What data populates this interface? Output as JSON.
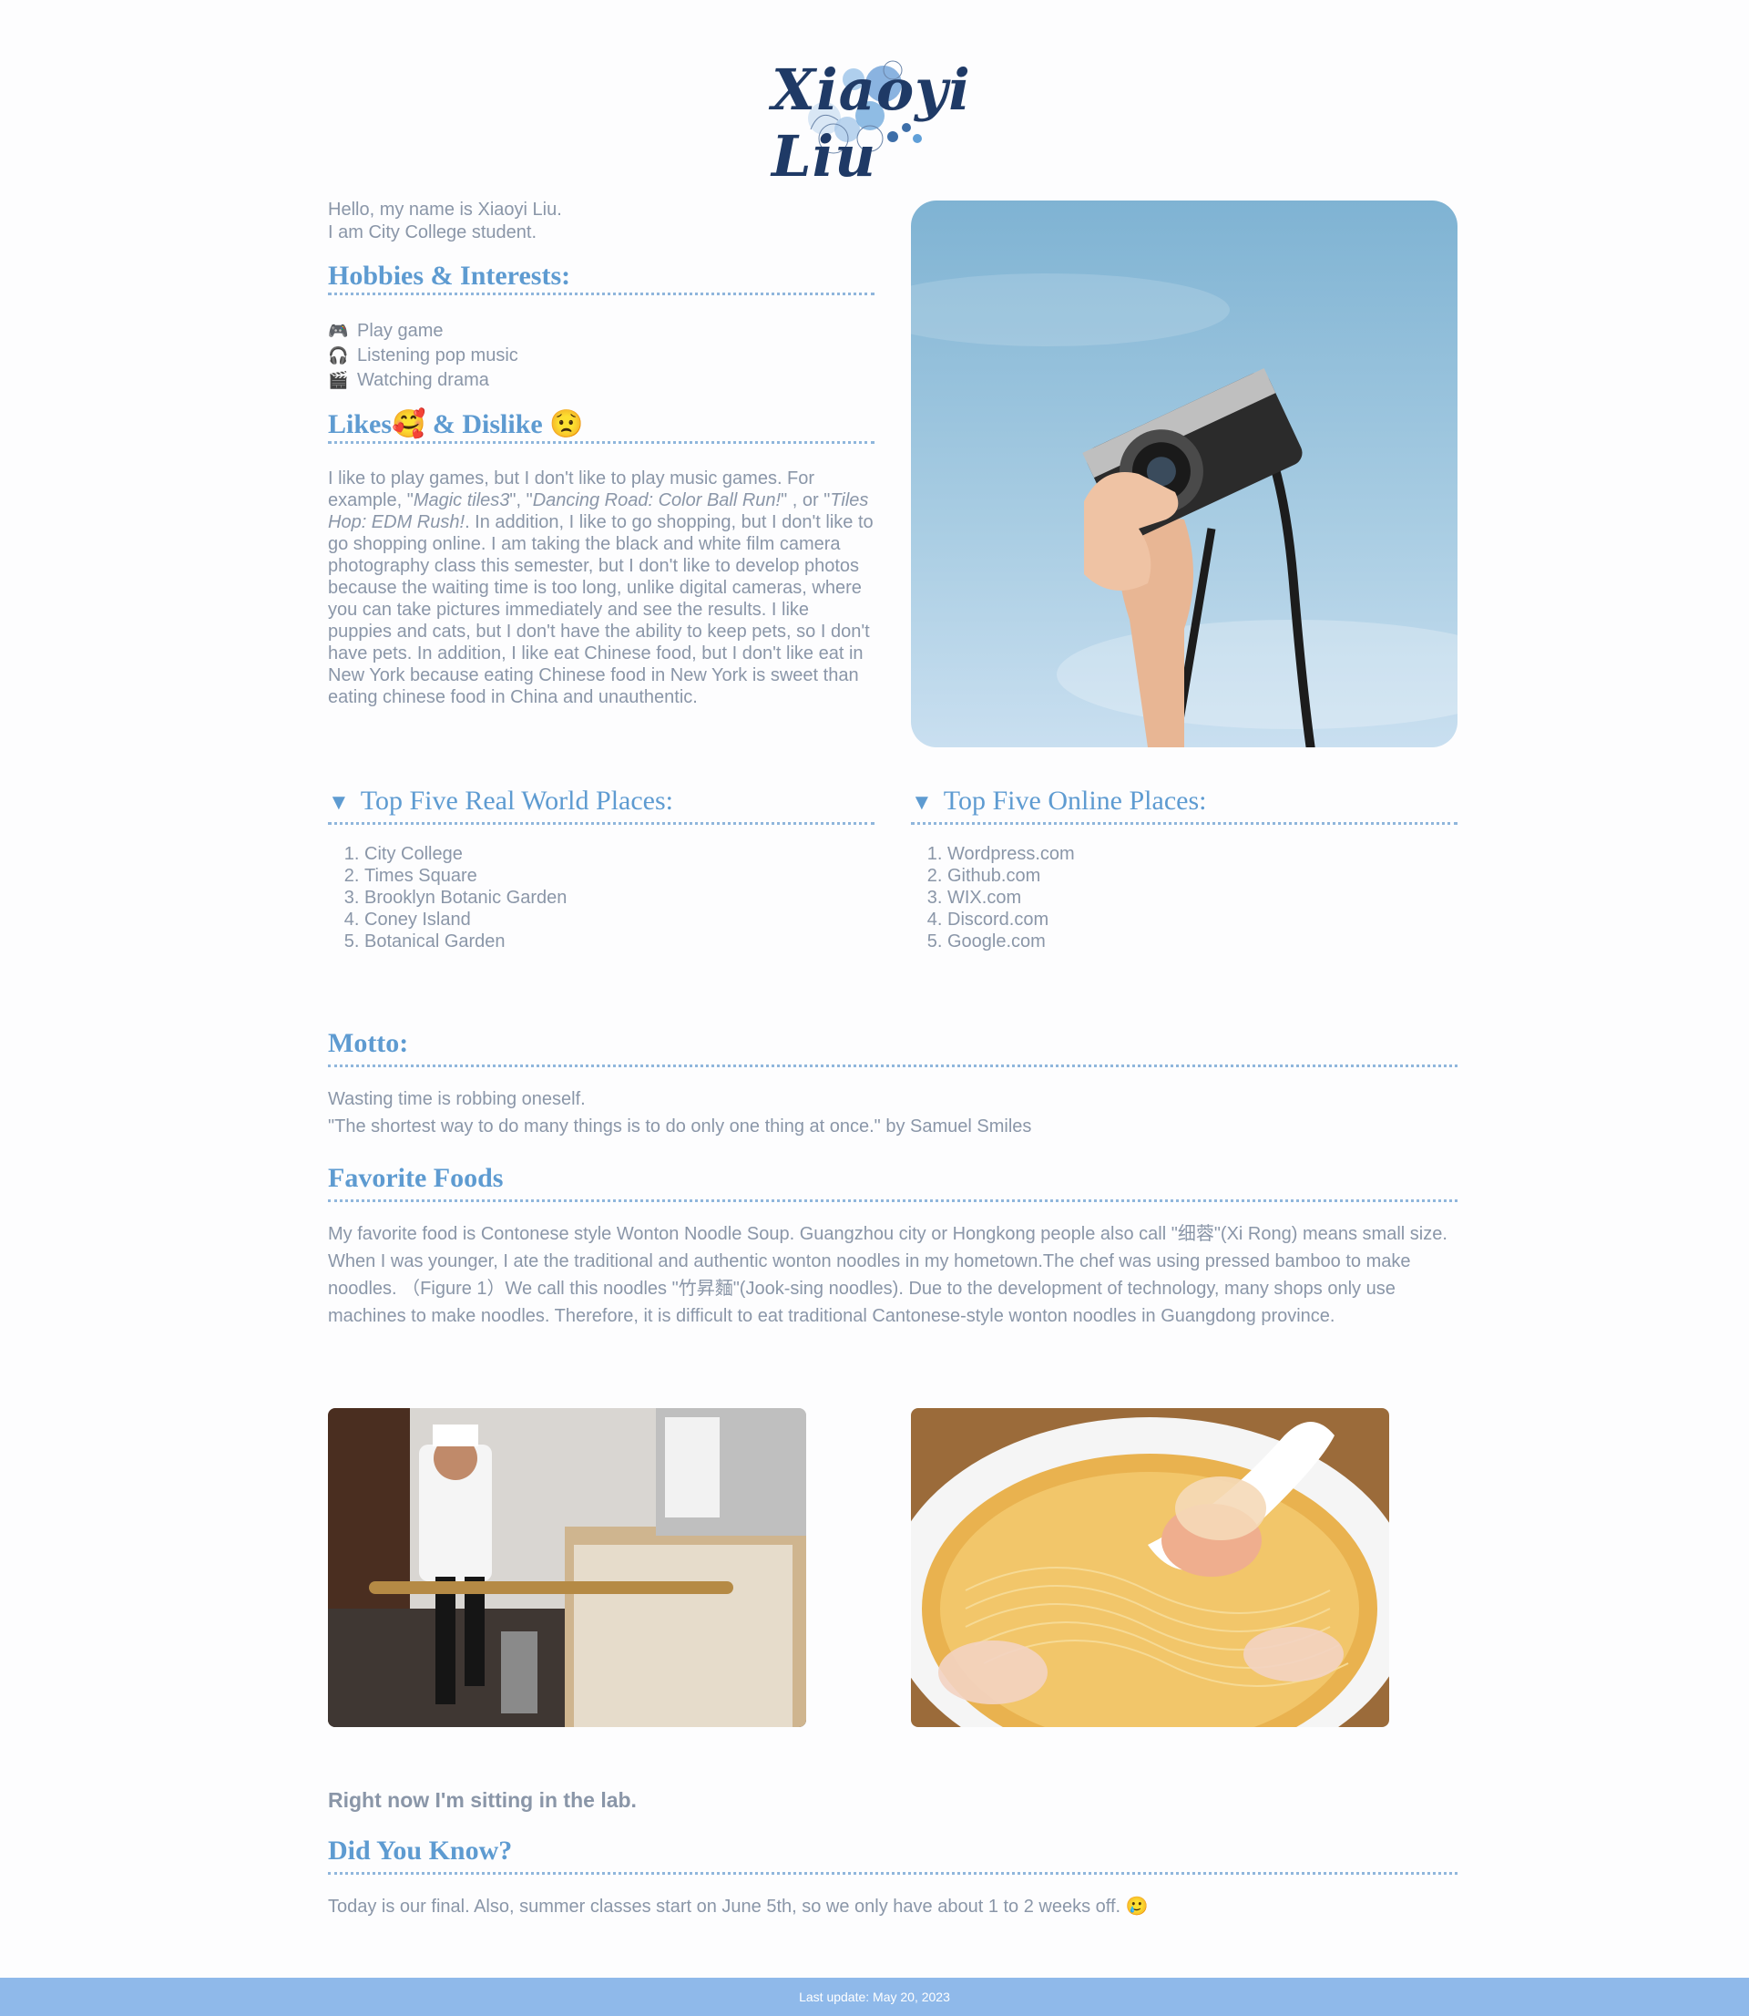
{
  "header": {
    "logo_text": "Xiaoyi Liu"
  },
  "intro": {
    "line1": "Hello, my name is Xiaoyi Liu.",
    "line2": "I am City College student."
  },
  "hobbies": {
    "heading": "Hobbies & Interests:",
    "items": [
      {
        "icon": "🎮",
        "label": "Play game"
      },
      {
        "icon": "🎧",
        "label": "Listening pop music"
      },
      {
        "icon": "🎬",
        "label": "Watching drama"
      }
    ]
  },
  "likes": {
    "heading_a": "Likes",
    "heading_b": "& Dislike",
    "emoji_like": "🥰",
    "emoji_dislike": "😟",
    "p1": "I like to play games, but I don't like to play music games. For example, \"",
    "game1": "Magic tiles3",
    "p2": "\", \"",
    "game2": "Dancing Road: Color Ball Run!",
    "p3": "\" , or \"",
    "game3": "Tiles Hop: EDM Rush!",
    "p4": ". In addition, I like to go shopping, but I don't like to go shopping online. I am taking the black and white film camera photography class this semester, but I don't like to develop photos because the waiting time is too long, unlike digital cameras, where you can take pictures immediately and see the results. I like puppies and cats, but I don't have the ability to keep pets, so I don't have pets. In addition, I like eat Chinese food, but I don't like eat in New York because eating Chinese food in New York is sweet than eating chinese food in China and unauthentic."
  },
  "real_places": {
    "heading": "Top Five Real World Places:",
    "items": [
      "City College",
      "Times Square",
      "Brooklyn Botanic Garden",
      "Coney Island",
      "Botanical Garden"
    ]
  },
  "online_places": {
    "heading": "Top Five Online Places:",
    "items": [
      "Wordpress.com",
      "Github.com",
      "WIX.com",
      "Discord.com",
      "Google.com"
    ]
  },
  "motto": {
    "heading": "Motto:",
    "line1": "Wasting time is robbing oneself.",
    "line2": "\"The shortest way to do many things is to do only one thing at once.\" by Samuel Smiles"
  },
  "foods": {
    "heading": "Favorite Foods",
    "text": "My favorite food is Contonese style Wonton Noodle Soup. Guangzhou city or Hongkong people also call \"细蓉\"(Xi Rong) means small size. When I was younger, I ate the traditional and authentic wonton noodles in my hometown.The chef was using pressed bamboo to make noodles. （Figure 1）We call this noodles \"竹昇麵\"(Jook-sing noodles). Due to the development of technology, many shops only use machines to make noodles. Therefore, it is difficult to eat traditional Cantonese-style wonton noodles in Guangdong province."
  },
  "status": "Right now I'm sitting in the lab.",
  "did_you_know": {
    "heading": "Did You Know?",
    "text": "Today is our final. Also, summer classes start on June 5th, so we only have about 1 to 2 weeks off.",
    "emoji": "🥲"
  },
  "footer": {
    "text": "Last update: May 20, 2023"
  }
}
